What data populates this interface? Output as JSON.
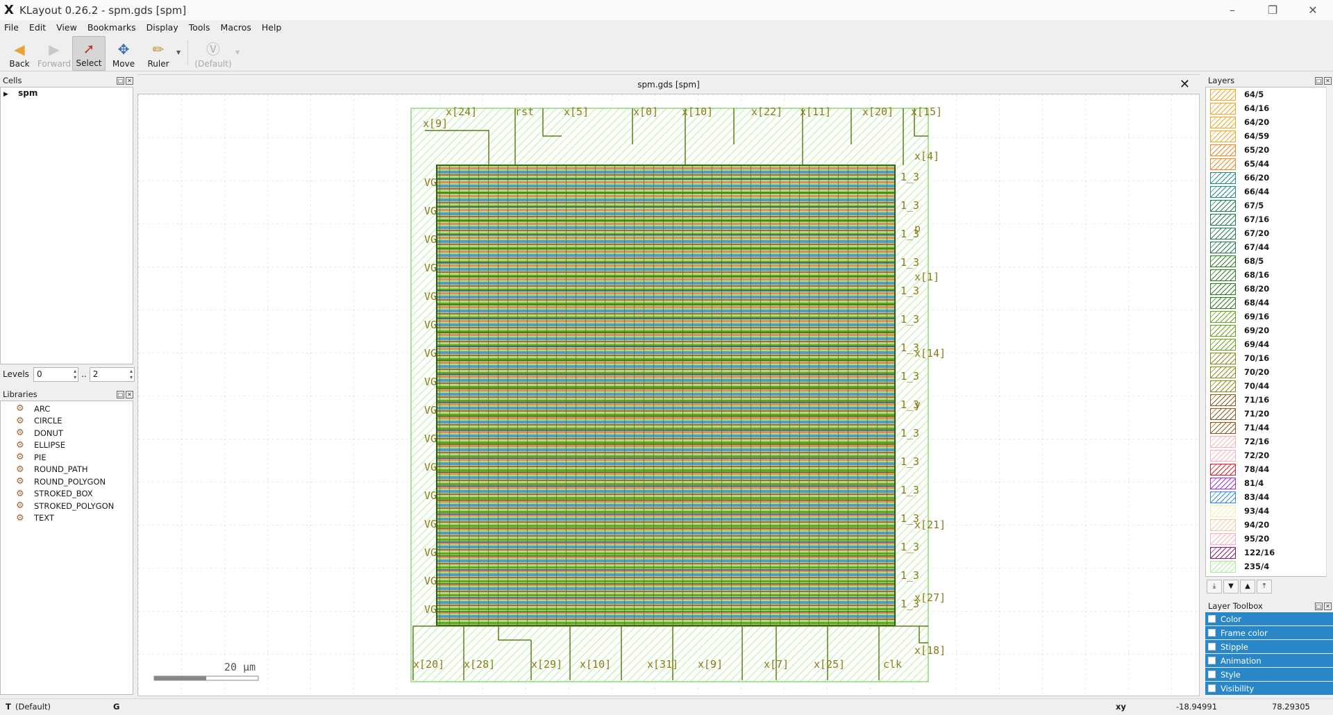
{
  "window": {
    "title": "KLayout 0.26.2 - spm.gds [spm]",
    "icon": "klayout-x-icon",
    "controls": [
      "minimize-icon",
      "restore-icon",
      "close-icon"
    ]
  },
  "menu": [
    "File",
    "Edit",
    "View",
    "Bookmarks",
    "Display",
    "Tools",
    "Macros",
    "Help"
  ],
  "toolbar": {
    "back": "Back",
    "forward": "Forward",
    "select": "Select",
    "move": "Move",
    "ruler": "Ruler",
    "text_default": "(Default)"
  },
  "cells": {
    "title": "Cells",
    "items": [
      {
        "name": "spm"
      }
    ]
  },
  "levels": {
    "label": "Levels",
    "from": "0",
    "sep": "..",
    "to": "2"
  },
  "libraries": {
    "title": "Libraries",
    "items": [
      "ARC",
      "CIRCLE",
      "DONUT",
      "ELLIPSE",
      "PIE",
      "ROUND_PATH",
      "ROUND_POLYGON",
      "STROKED_BOX",
      "STROKED_POLYGON",
      "TEXT"
    ]
  },
  "view": {
    "tab": "spm.gds [spm]",
    "scale_label": "20 µm",
    "top_pins": [
      "x[24]",
      "rst",
      "x[5]",
      "x[0]",
      "x[10]",
      "x[22]",
      "x[11]",
      "x[20]",
      "x[15]"
    ],
    "bottom_pins": [
      "x[20]",
      "x[28]",
      "x[29]",
      "x[10]",
      "x[31]",
      "x[9]",
      "x[7]",
      "x[25]",
      "clk"
    ],
    "left_pins": [
      "x[9]"
    ],
    "right_pins": [
      "x[4]",
      "p",
      "x[1]",
      "x[14]",
      "y",
      "x[21]",
      "x[27]",
      "x[18]"
    ],
    "right_cell_label": "1_3",
    "left_cell_label": "VG"
  },
  "layers": {
    "title": "Layers",
    "items": [
      {
        "name": "64/5",
        "color": "#f5a623"
      },
      {
        "name": "64/16",
        "color": "#f5a623"
      },
      {
        "name": "64/20",
        "color": "#f5a623"
      },
      {
        "name": "64/59",
        "color": "#f5a623"
      },
      {
        "name": "65/20",
        "color": "#f08a24"
      },
      {
        "name": "65/44",
        "color": "#f08a24"
      },
      {
        "name": "66/20",
        "color": "#1f8a8a"
      },
      {
        "name": "66/44",
        "color": "#1f8a8a"
      },
      {
        "name": "67/5",
        "color": "#1e7d4a"
      },
      {
        "name": "67/16",
        "color": "#1e7d4a"
      },
      {
        "name": "67/20",
        "color": "#1e7d4a"
      },
      {
        "name": "67/44",
        "color": "#1e7d4a"
      },
      {
        "name": "68/5",
        "color": "#2e7d1f"
      },
      {
        "name": "68/16",
        "color": "#2e7d1f"
      },
      {
        "name": "68/20",
        "color": "#2e7d1f"
      },
      {
        "name": "68/44",
        "color": "#2e7d1f"
      },
      {
        "name": "69/16",
        "color": "#6aa224"
      },
      {
        "name": "69/20",
        "color": "#6aa224"
      },
      {
        "name": "69/44",
        "color": "#6aa224"
      },
      {
        "name": "70/16",
        "color": "#8a8a1c"
      },
      {
        "name": "70/20",
        "color": "#8a8a1c"
      },
      {
        "name": "70/44",
        "color": "#8a8a1c"
      },
      {
        "name": "71/16",
        "color": "#8a5a1c"
      },
      {
        "name": "71/20",
        "color": "#8a5a1c"
      },
      {
        "name": "71/44",
        "color": "#8a5a1c"
      },
      {
        "name": "72/16",
        "color": "#f5b5c0"
      },
      {
        "name": "72/20",
        "color": "#f5b5c0"
      },
      {
        "name": "78/44",
        "color": "#d92020"
      },
      {
        "name": "81/4",
        "color": "#9b2ed9"
      },
      {
        "name": "83/44",
        "color": "#2e8ae6"
      },
      {
        "name": "93/44",
        "color": "#f7f0b0"
      },
      {
        "name": "94/20",
        "color": "#f5c8a8"
      },
      {
        "name": "95/20",
        "color": "#f5b5c0"
      },
      {
        "name": "122/16",
        "color": "#8a1c6a"
      },
      {
        "name": "235/4",
        "color": "#a8ef9a"
      }
    ]
  },
  "layer_toolbox": {
    "title": "Layer Toolbox",
    "items": [
      "Color",
      "Frame color",
      "Stipple",
      "Animation",
      "Style",
      "Visibility"
    ]
  },
  "status": {
    "mode": "T",
    "text": "(Default)",
    "grid": "G",
    "coord_label": "xy",
    "x": "-18.94991",
    "y": "78.29305"
  }
}
